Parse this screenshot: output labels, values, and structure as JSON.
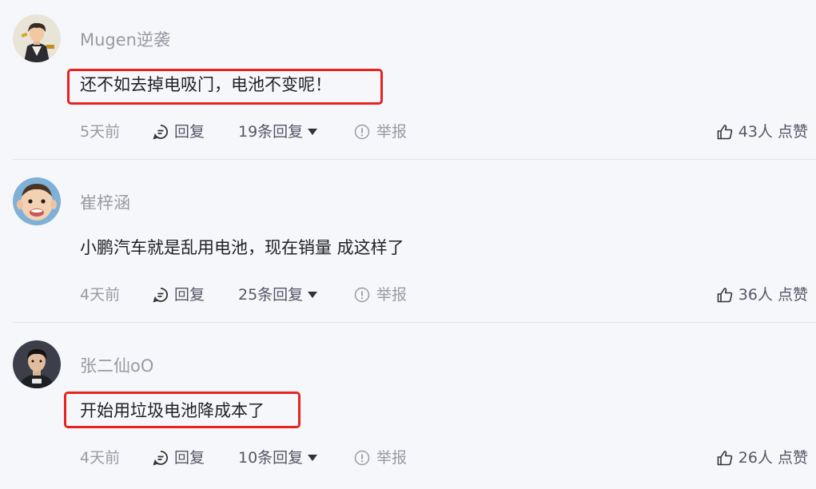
{
  "comments": [
    {
      "username": "Mugen逆袭",
      "content": "还不如去掉电吸门，电池不变呢！",
      "time": "5天前",
      "reply_label": "回复",
      "replies_label": "19条回复",
      "report_label": "举报",
      "likes_label": "43人 点赞",
      "avatar": "person-avatar",
      "highlighted": true
    },
    {
      "username": "崔梓涵",
      "content": "小鹏汽车就是乱用电池，现在销量 成这样了",
      "time": "4天前",
      "reply_label": "回复",
      "replies_label": "25条回复",
      "report_label": "举报",
      "likes_label": "36人 点赞",
      "avatar": "baby-avatar",
      "highlighted": false
    },
    {
      "username": "张二仙oO",
      "content": "开始用垃圾电池降成本了",
      "time": "4天前",
      "reply_label": "回复",
      "replies_label": "10条回复",
      "report_label": "举报",
      "likes_label": "26人 点赞",
      "avatar": "man-avatar",
      "highlighted": true
    }
  ],
  "colors": {
    "background": "#f6f7fb",
    "highlight_border": "#e8231f",
    "username": "#9a9aa3",
    "text": "#222226",
    "action_text": "#555666"
  }
}
